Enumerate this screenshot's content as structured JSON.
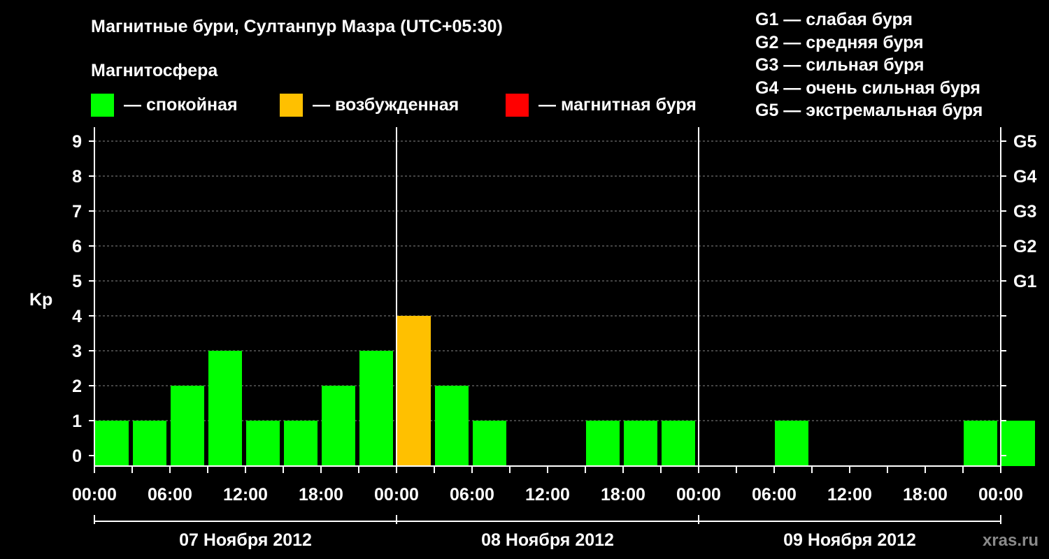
{
  "header": {
    "title": "Магнитные бури, Султанпур Мазра (UTC+05:30)",
    "magnetosphere_label": "Магнитосфера"
  },
  "legend": [
    {
      "color": "#00ff00",
      "label": "— спокойная"
    },
    {
      "color": "#ffc000",
      "label": "— возбужденная"
    },
    {
      "color": "#ff0000",
      "label": "— магнитная буря"
    }
  ],
  "storm_levels": [
    "G1 — слабая буря",
    "G2 — средняя буря",
    "G3 — сильная буря",
    "G4 — очень сильная буря",
    "G5 — экстремальная буря"
  ],
  "watermark": "xras.ru",
  "chart_data": {
    "type": "bar",
    "ylabel": "Kp",
    "ylim": [
      0,
      9
    ],
    "yticks": [
      0,
      1,
      2,
      3,
      4,
      5,
      6,
      7,
      8,
      9
    ],
    "right_axis_labels": [
      {
        "kp": 5,
        "label": "G1"
      },
      {
        "kp": 6,
        "label": "G2"
      },
      {
        "kp": 7,
        "label": "G3"
      },
      {
        "kp": 8,
        "label": "G4"
      },
      {
        "kp": 9,
        "label": "G5"
      }
    ],
    "x_tick_labels": [
      "00:00",
      "06:00",
      "12:00",
      "18:00",
      "00:00",
      "06:00",
      "12:00",
      "18:00",
      "00:00",
      "06:00",
      "12:00",
      "18:00",
      "00:00"
    ],
    "days": [
      "07 Ноября 2012",
      "08 Ноября 2012",
      "09 Ноября 2012"
    ],
    "grid": "dashed horizontal",
    "colors": {
      "quiet": "#00ff00",
      "active": "#ffc000",
      "storm": "#ff0000"
    },
    "values": [
      1,
      1,
      2,
      3,
      1,
      1,
      2,
      3,
      4,
      2,
      1,
      0,
      0,
      1,
      1,
      1,
      0,
      0,
      1,
      0,
      0,
      0,
      0,
      1,
      1
    ],
    "bar_status": [
      "quiet",
      "quiet",
      "quiet",
      "quiet",
      "quiet",
      "quiet",
      "quiet",
      "quiet",
      "active",
      "quiet",
      "quiet",
      "quiet",
      "quiet",
      "quiet",
      "quiet",
      "quiet",
      "quiet",
      "quiet",
      "quiet",
      "quiet",
      "quiet",
      "quiet",
      "quiet",
      "quiet",
      "quiet"
    ],
    "interval_hours": 3
  }
}
